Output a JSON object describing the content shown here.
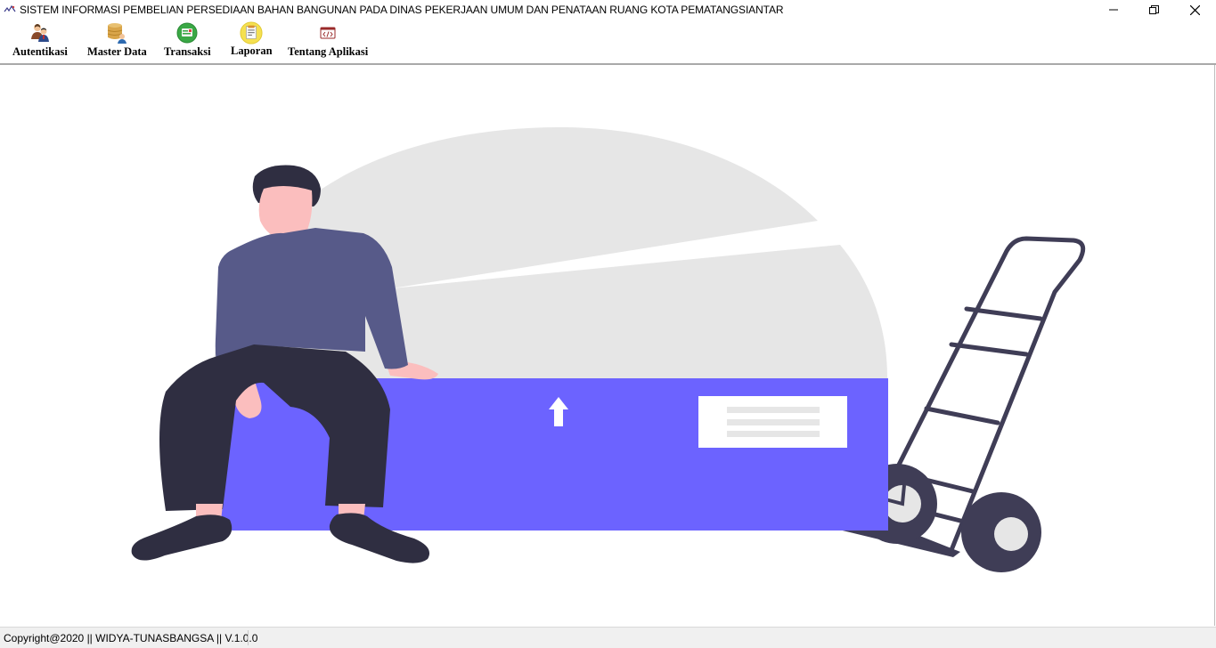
{
  "window": {
    "title": "SISTEM INFORMASI PEMBELIAN PERSEDIAAN  BAHAN BANGUNAN PADA DINAS PEKERJAAN UMUM DAN PENATAAN RUANG KOTA PEMATANGSIANTAR",
    "controls": [
      "minimize-icon",
      "restore-icon",
      "close-icon"
    ]
  },
  "toolbar": {
    "items": [
      {
        "label": "Autentikasi",
        "icon": "users-icon"
      },
      {
        "label": "Master Data",
        "icon": "database-icon"
      },
      {
        "label": "Transaksi",
        "icon": "transaction-icon"
      },
      {
        "label": "Laporan",
        "icon": "report-icon"
      },
      {
        "label": "Tentang Aplikasi",
        "icon": "code-icon"
      }
    ]
  },
  "colors": {
    "accent_box": "#6c63ff",
    "shirt": "#575a89",
    "pants": "#2f2e41",
    "skin": "#fbbebe",
    "backdrop": "#e6e6e6"
  },
  "status": {
    "text": "Copyright@2020 || WIDYA-TUNASBANGSA || V.1.0.0"
  }
}
